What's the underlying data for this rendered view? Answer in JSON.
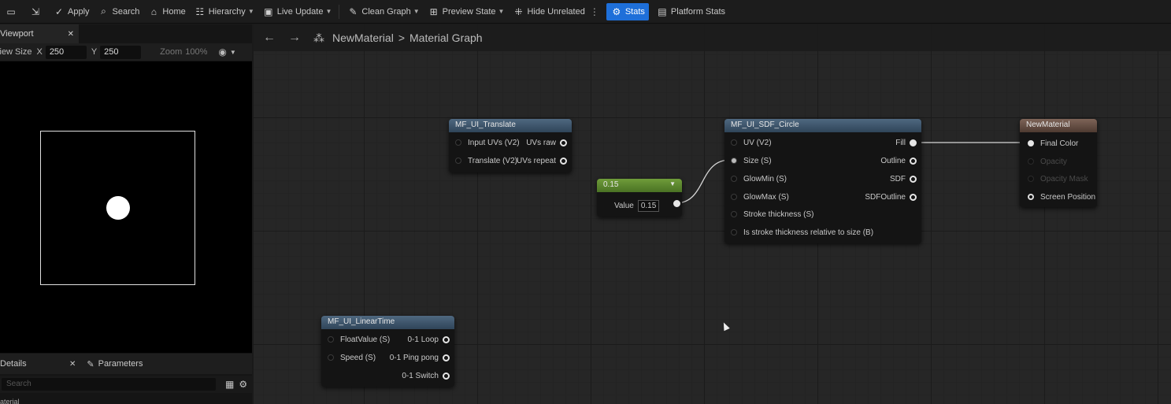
{
  "toolbar": {
    "items": [
      {
        "name": "apply",
        "label": "Apply",
        "icon": "apply-icon"
      },
      {
        "name": "search",
        "label": "Search",
        "icon": "search-icon"
      },
      {
        "name": "home",
        "label": "Home",
        "icon": "home-icon"
      },
      {
        "name": "hierarchy",
        "label": "Hierarchy",
        "icon": "hierarchy-icon"
      },
      {
        "name": "live-update",
        "label": "Live Update",
        "icon": "live-update-icon"
      },
      {
        "name": "clean-graph",
        "label": "Clean Graph",
        "icon": "clean-graph-icon"
      },
      {
        "name": "preview-state",
        "label": "Preview State",
        "icon": "preview-state-icon"
      },
      {
        "name": "hide-unrelated",
        "label": "Hide Unrelated",
        "icon": "hide-unrelated-icon"
      },
      {
        "name": "stats",
        "label": "Stats",
        "icon": "stats-icon"
      },
      {
        "name": "platform-stats",
        "label": "Platform Stats",
        "icon": "platform-stats-icon"
      }
    ],
    "active": "Stats"
  },
  "viewport": {
    "tab_label": "Viewport",
    "size_label": "view Size",
    "x_label": "X",
    "x_value": "250",
    "y_label": "Y",
    "y_value": "250",
    "zoom_label": "Zoom",
    "zoom_value": "100%"
  },
  "details": {
    "tab_label": "Details",
    "params_label": "Parameters",
    "search_placeholder": "Search",
    "footer_text": "aterial"
  },
  "breadcrumb": {
    "root": "NewMaterial",
    "separator": ">",
    "current": "Material Graph"
  },
  "nodes": {
    "translate": {
      "title": "MF_UI_Translate",
      "inputs": [
        "Input UVs (V2)",
        "Translate (V2)"
      ],
      "outputs": [
        "UVs raw",
        "UVs repeat"
      ]
    },
    "constant": {
      "title": "0.15",
      "value_label": "Value",
      "value": "0.15",
      "accent": "#5b8a2a"
    },
    "circle": {
      "title": "MF_UI_SDF_Circle",
      "inputs": [
        "UV (V2)",
        "Size (S)",
        "GlowMin (S)",
        "GlowMax (S)",
        "Stroke thickness (S)",
        "Is stroke thickness relative to size (B)"
      ],
      "outputs": [
        "Fill",
        "Outline",
        "SDF",
        "SDFOutline"
      ]
    },
    "material": {
      "title": "NewMaterial",
      "inputs": [
        "Final Color",
        "Opacity",
        "Opacity Mask",
        "Screen Position"
      ],
      "accent": "#6b5348"
    },
    "lineartime": {
      "title": "MF_UI_LinearTime",
      "inputs": [
        "FloatValue (S)",
        "Speed (S)"
      ],
      "outputs": [
        "0-1 Loop",
        "0-1 Ping pong",
        "0-1 Switch"
      ]
    }
  }
}
